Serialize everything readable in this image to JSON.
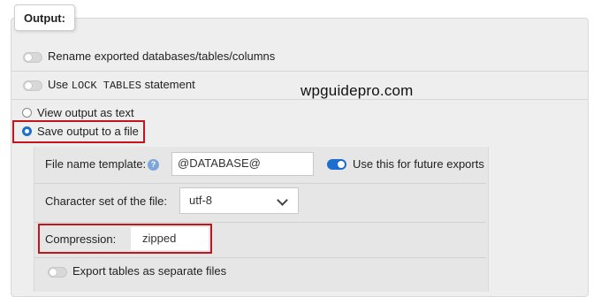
{
  "output": {
    "legend": "Output:",
    "rename_label": "Rename exported databases/tables/columns",
    "lock_tables": {
      "prefix": "Use",
      "code": "LOCK TABLES",
      "suffix": "statement"
    },
    "view_output_label": "View output as text",
    "save_output_label": "Save output to a file"
  },
  "save_options": {
    "file_name_template_label": "File name template:",
    "help_icon": "?",
    "file_name_template_value": "@DATABASE@",
    "future_exports_label": "Use this for future exports",
    "charset_label": "Character set of the file:",
    "charset_value": "utf-8",
    "compression_label": "Compression:",
    "compression_value": "zipped",
    "separate_files_label": "Export tables as separate files"
  },
  "watermark": "wpguidepro.com",
  "states": {
    "rename_toggle": false,
    "lock_tables_toggle": false,
    "view_output_radio": false,
    "save_output_radio": true,
    "future_exports_toggle": true,
    "separate_files_toggle": false
  },
  "colors": {
    "accent": "#1a6fd1",
    "highlight_box": "#c0161c",
    "panel": "#eeeeee"
  }
}
